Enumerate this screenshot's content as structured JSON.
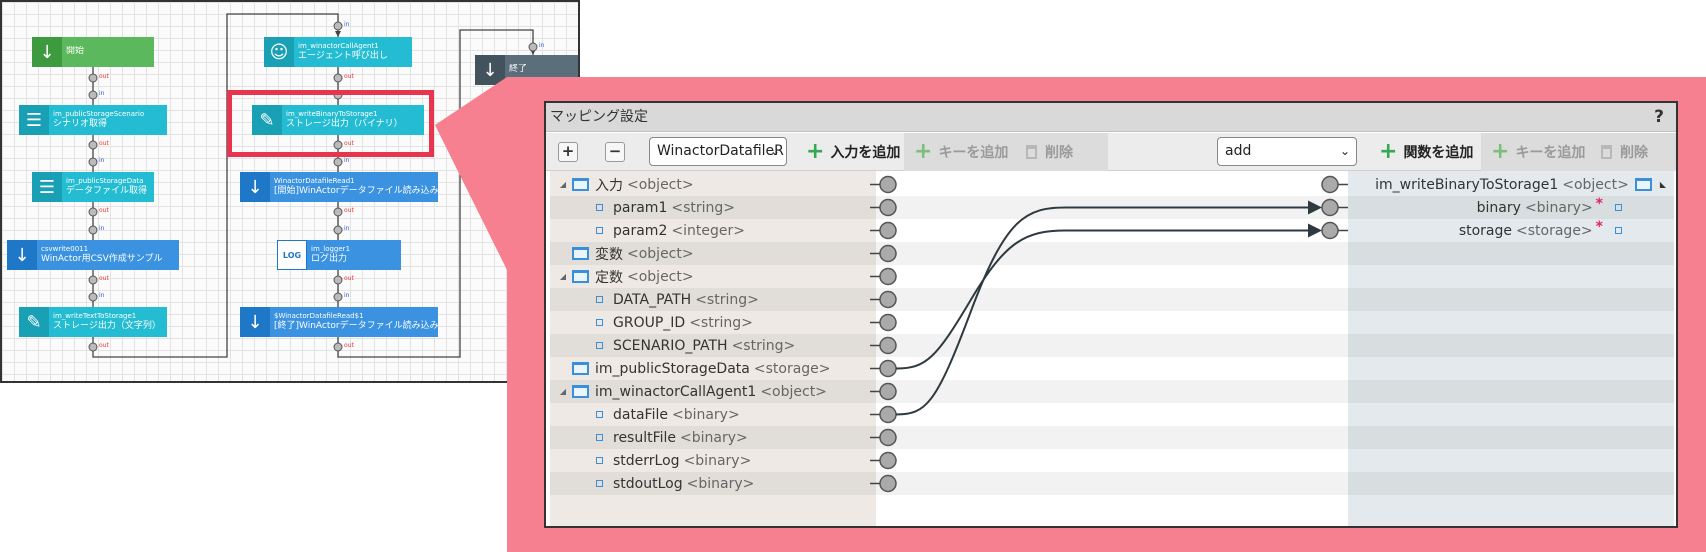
{
  "flow": {
    "nodes": [
      {
        "id": "start",
        "sub": "",
        "label": "開始",
        "icon": "down-arrow-icon",
        "color": "green"
      },
      {
        "id": "scenario",
        "sub": "im_publicStorageScenario",
        "label": "シナリオ取得",
        "icon": "storage-icon",
        "color": "teal"
      },
      {
        "id": "datafile",
        "sub": "im_publicStorageData",
        "label": "データファイル取得",
        "icon": "storage-icon",
        "color": "teal"
      },
      {
        "id": "csv",
        "sub": "csvwrite0011",
        "label": "WinActor用CSV作成サンプル",
        "icon": "down-arrow-icon",
        "color": "blue"
      },
      {
        "id": "writetext",
        "sub": "im_writeTextToStorage1",
        "label": "ストレージ出力（文字列）",
        "icon": "storage-write-icon",
        "color": "teal"
      },
      {
        "id": "agent",
        "sub": "im_winactorCallAgent1",
        "label": "エージェント呼び出し",
        "icon": "robot-icon",
        "color": "teal"
      },
      {
        "id": "writebinary",
        "sub": "im_writeBinaryToStorage1",
        "label": "ストレージ出力（バイナリ）",
        "icon": "storage-write-icon",
        "color": "teal"
      },
      {
        "id": "read1",
        "sub": "WinactorDatafileRead1",
        "label": "[開始]WinActorデータファイル読み込み",
        "icon": "down-arrow-icon",
        "color": "blue"
      },
      {
        "id": "logger",
        "sub": "im_logger1",
        "label": "ログ出力",
        "icon": "log-icon",
        "color": "blue"
      },
      {
        "id": "read1end",
        "sub": "$WinactorDatafileRead$1",
        "label": "[終了]WinActorデータファイル読み込み",
        "icon": "down-arrow-icon",
        "color": "blue"
      },
      {
        "id": "end",
        "sub": "",
        "label": "終了",
        "icon": "down-arrow-icon",
        "color": "slate"
      }
    ],
    "port_in": "in",
    "port_out": "out",
    "log_icon_text": "LOG"
  },
  "dialog": {
    "title": "マッピング設定",
    "help": "?",
    "toolbar": {
      "add_square": "+",
      "remove_square": "−",
      "source_select": "WinactorDatafileR",
      "add_input": "入力を追加",
      "add_key": "キーを追加",
      "delete": "削除",
      "function_select": "add",
      "add_function": "関数を追加",
      "add_key_right": "キーを追加",
      "delete_right": "削除"
    },
    "left_tree": [
      {
        "name": "入力",
        "type": "<object>",
        "kind": "node",
        "expand": "◢"
      },
      {
        "name": "param1",
        "type": "<string>",
        "kind": "leaf"
      },
      {
        "name": "param2",
        "type": "<integer>",
        "kind": "leaf"
      },
      {
        "name": "変数",
        "type": "<object>",
        "kind": "node",
        "expand": ""
      },
      {
        "name": "定数",
        "type": "<object>",
        "kind": "node",
        "expand": "◢"
      },
      {
        "name": "DATA_PATH",
        "type": "<string>",
        "kind": "leaf"
      },
      {
        "name": "GROUP_ID",
        "type": "<string>",
        "kind": "leaf"
      },
      {
        "name": "SCENARIO_PATH",
        "type": "<string>",
        "kind": "leaf"
      },
      {
        "name": "im_publicStorageData",
        "type": "<storage>",
        "kind": "node",
        "expand": ""
      },
      {
        "name": "im_winactorCallAgent1",
        "type": "<object>",
        "kind": "node",
        "expand": "◢"
      },
      {
        "name": "dataFile",
        "type": "<binary>",
        "kind": "leaf"
      },
      {
        "name": "resultFile",
        "type": "<binary>",
        "kind": "leaf"
      },
      {
        "name": "stderrLog",
        "type": "<binary>",
        "kind": "leaf"
      },
      {
        "name": "stdoutLog",
        "type": "<binary>",
        "kind": "leaf"
      }
    ],
    "right_tree": [
      {
        "name": "im_writeBinaryToStorage1",
        "type": "<object>",
        "kind": "node",
        "expand": "◣",
        "required": ""
      },
      {
        "name": "binary",
        "type": "<binary>",
        "kind": "leaf",
        "required": "*"
      },
      {
        "name": "storage",
        "type": "<storage>",
        "kind": "leaf",
        "required": "*"
      }
    ],
    "mappings": [
      {
        "from": "dataFile",
        "to": "binary"
      },
      {
        "from": "im_publicStorageData",
        "to": "storage"
      }
    ]
  }
}
